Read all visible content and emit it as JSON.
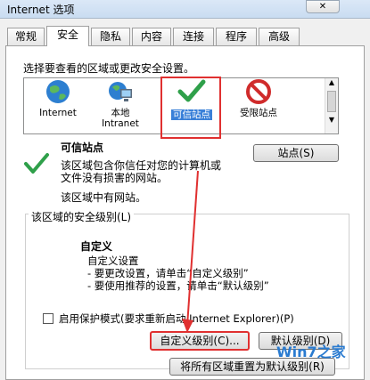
{
  "window": {
    "title": "Internet 选项"
  },
  "tabs": [
    "常规",
    "安全",
    "隐私",
    "内容",
    "连接",
    "程序",
    "高级"
  ],
  "security": {
    "select_zone_label": "选择要查看的区域或更改安全设置。",
    "zones": [
      {
        "line1": "Internet",
        "line2": ""
      },
      {
        "line1": "本地",
        "line2": "Intranet"
      },
      {
        "line1": "可信站点",
        "line2": ""
      },
      {
        "line1": "受限站点",
        "line2": ""
      }
    ],
    "selected_zone_title": "可信站点",
    "zone_description": [
      "该区域包含你信任对您的计算机或",
      "文件没有损害的网站。"
    ],
    "zone_has_sites": "该区域中有网站。",
    "sites_button": "站点(S)",
    "security_level_label": "该区域的安全级别(L)",
    "custom_title": "自定义",
    "custom_lines": [
      "自定义设置",
      "- 要更改设置，请单击“自定义级别”",
      "- 要使用推荐的设置，请单击“默认级别”"
    ],
    "protected_mode": "启用保护模式(要求重新启动 Internet Explorer)(P)",
    "custom_level_button": "自定义级别(C)...",
    "default_level_button": "默认级别(D)",
    "reset_all_button": "将所有区域重置为默认级别(R)"
  },
  "watermark": "Win7之家"
}
